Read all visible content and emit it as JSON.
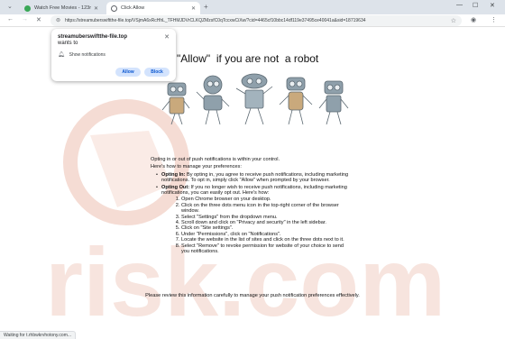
{
  "tabs": [
    {
      "title": "Watch Free Movies - 123movies...",
      "active": false
    },
    {
      "title": "Click Allow",
      "active": true
    }
  ],
  "window": {
    "minimize": "—",
    "maximize": "☐",
    "close": "✕",
    "tab_search": "⌄",
    "new_tab": "+"
  },
  "address_bar": {
    "url": "https://streamuberswiftthe-file.top/VSjmA6xRcHhL_TFHMJDVrCLKQZMzsfC0qTccxwCiXw/?cid=4465cf10bbc14df119e37495ce40041a&sid=18719634"
  },
  "permission_popup": {
    "site": "streamuberswiftthe-file.top",
    "wants": "wants to",
    "permission": "Show notifications",
    "allow": "Allow",
    "block": "Block"
  },
  "page": {
    "headline": "\"Allow\"  if you are not  a robot",
    "intro_1": "Opting in or out of push notifications is within your control.",
    "intro_2": "Here's how to manage your preferences:",
    "opt_in_label": "Opting In:",
    "opt_in_text": " By opting in, you agree to receive push notifications, including marketing notifications. To opt in, simply click \"Allow\" when prompted by your browser.",
    "opt_out_label": "Opting Out:",
    "opt_out_text": " If you no longer wish to receive push notifications, including marketing notifications, you can easily opt out. Here's how:",
    "steps": [
      "Open Chrome browser on your desktop.",
      "Click on the three dots menu icon in the top-right corner of the browser window.",
      "Select \"Settings\" from the dropdown menu.",
      "Scroll down and click on \"Privacy and security\" in the left sidebar.",
      "Click on \"Site settings\".",
      "Under \"Permissions\", click on \"Notifications\".",
      "Locate the website in the list of sites and click on the three dots next to it.",
      "Select \"Remove\" to revoke permission for website of your choice to send you notifications."
    ],
    "footer": "Please review this information carefully to manage your push notification preferences effectively."
  },
  "status_bar": "Waiting for t.rhbwkrvhotony.com...",
  "colors": {
    "accent": "#0b57d0",
    "watermark": "#f5dcd4",
    "robot": "#8a9aa5"
  }
}
